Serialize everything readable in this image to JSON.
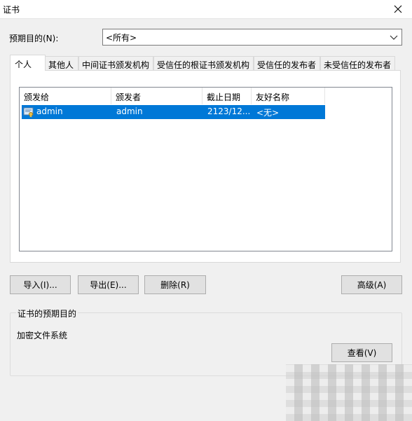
{
  "window": {
    "title": "证书"
  },
  "purpose": {
    "label": "预期目的(N):",
    "value": "<所有>"
  },
  "tabs": [
    {
      "label": "个人"
    },
    {
      "label": "其他人"
    },
    {
      "label": "中间证书颁发机构"
    },
    {
      "label": "受信任的根证书颁发机构"
    },
    {
      "label": "受信任的发布者"
    },
    {
      "label": "未受信任的发布者"
    }
  ],
  "list": {
    "columns": [
      "颁发给",
      "颁发者",
      "截止日期",
      "友好名称"
    ],
    "rows": [
      {
        "issued_to": "admin",
        "issued_by": "admin",
        "expiry": "2123/12...",
        "friendly_name": "<无>",
        "icon": "certificate-icon"
      }
    ]
  },
  "buttons": {
    "import": "导入(I)...",
    "export": "导出(E)...",
    "remove": "删除(R)",
    "advanced": "高级(A)",
    "view": "查看(V)"
  },
  "purposes_group": {
    "title": "证书的预期目的",
    "value": "加密文件系统"
  },
  "colors": {
    "selection": "#0078d7",
    "window_bg": "#f0f0f0"
  }
}
